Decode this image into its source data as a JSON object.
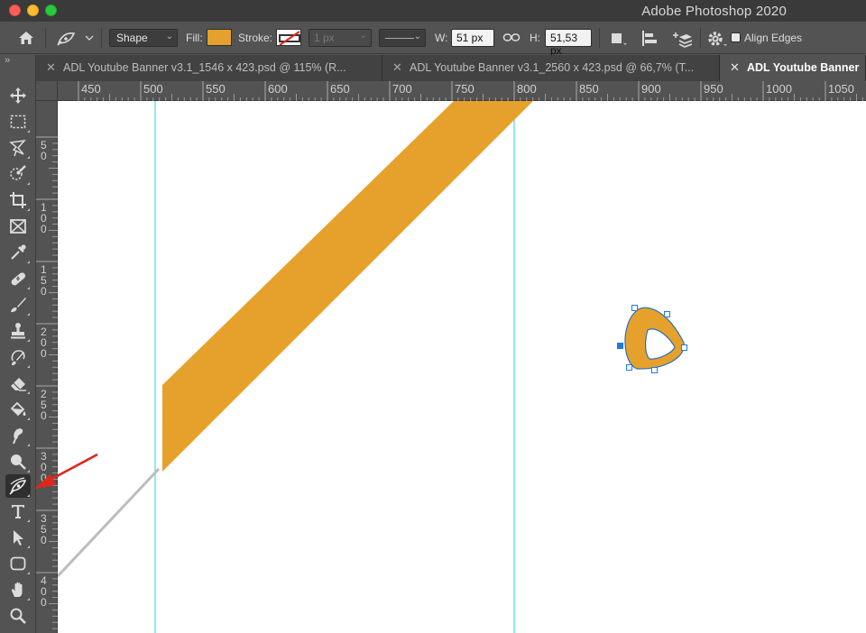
{
  "window": {
    "title": "Adobe Photoshop 2020"
  },
  "options_bar": {
    "shape_mode": "Shape",
    "fill_label": "Fill:",
    "fill_color": "#e5a12b",
    "stroke_label": "Stroke:",
    "stroke_width": "1 px",
    "width_label": "W:",
    "width_value": "51 px",
    "height_label": "H:",
    "height_value": "51,53 px",
    "align_edges_label": "Align Edges",
    "align_edges_checked": false
  },
  "tabs": [
    {
      "label": "ADL Youtube Banner v3.1_1546 x 423.psd @ 115% (R...",
      "active": false
    },
    {
      "label": "ADL Youtube Banner v3.1_2560 x 423.psd @ 66,7% (T...",
      "active": false
    },
    {
      "label": "ADL Youtube Banner",
      "active": true
    }
  ],
  "tools": [
    {
      "name": "move-tool",
      "icon": "move-icon"
    },
    {
      "name": "marquee-tool",
      "icon": "marquee-icon"
    },
    {
      "name": "lasso-tool",
      "icon": "lasso-icon"
    },
    {
      "name": "quick-selection-tool",
      "icon": "quick-selection-icon"
    },
    {
      "name": "crop-tool",
      "icon": "crop-icon"
    },
    {
      "name": "frame-tool",
      "icon": "frame-icon"
    },
    {
      "name": "eyedropper-tool",
      "icon": "eyedropper-icon"
    },
    {
      "name": "healing-brush-tool",
      "icon": "bandage-icon"
    },
    {
      "name": "brush-tool",
      "icon": "brush-icon"
    },
    {
      "name": "clone-stamp-tool",
      "icon": "stamp-icon"
    },
    {
      "name": "history-brush-tool",
      "icon": "history-brush-icon"
    },
    {
      "name": "eraser-tool",
      "icon": "eraser-icon"
    },
    {
      "name": "paint-bucket-tool",
      "icon": "paint-bucket-icon"
    },
    {
      "name": "smudge-tool",
      "icon": "smudge-icon"
    },
    {
      "name": "dodge-tool",
      "icon": "dodge-icon"
    },
    {
      "name": "curvature-pen-tool",
      "icon": "curvature-pen-icon",
      "selected": true
    },
    {
      "name": "type-tool",
      "icon": "type-icon"
    },
    {
      "name": "path-selection-tool",
      "icon": "arrow-icon"
    },
    {
      "name": "rectangle-tool",
      "icon": "rounded-rectangle-icon"
    },
    {
      "name": "hand-tool",
      "icon": "hand-icon"
    },
    {
      "name": "zoom-tool",
      "icon": "zoom-icon"
    }
  ],
  "ruler": {
    "horizontal_ticks": [
      "450",
      "500",
      "550",
      "600",
      "650",
      "700",
      "750",
      "800",
      "850",
      "900",
      "950",
      "1000",
      "1050"
    ],
    "vertical_ticks": [
      "50",
      "100",
      "150",
      "200",
      "250",
      "300",
      "350",
      "400"
    ]
  },
  "colors": {
    "accent_orange": "#e5a12b",
    "guide": "#66e0e6",
    "path_blue": "#1f7be0",
    "annotation_arrow": "#e0251b"
  }
}
